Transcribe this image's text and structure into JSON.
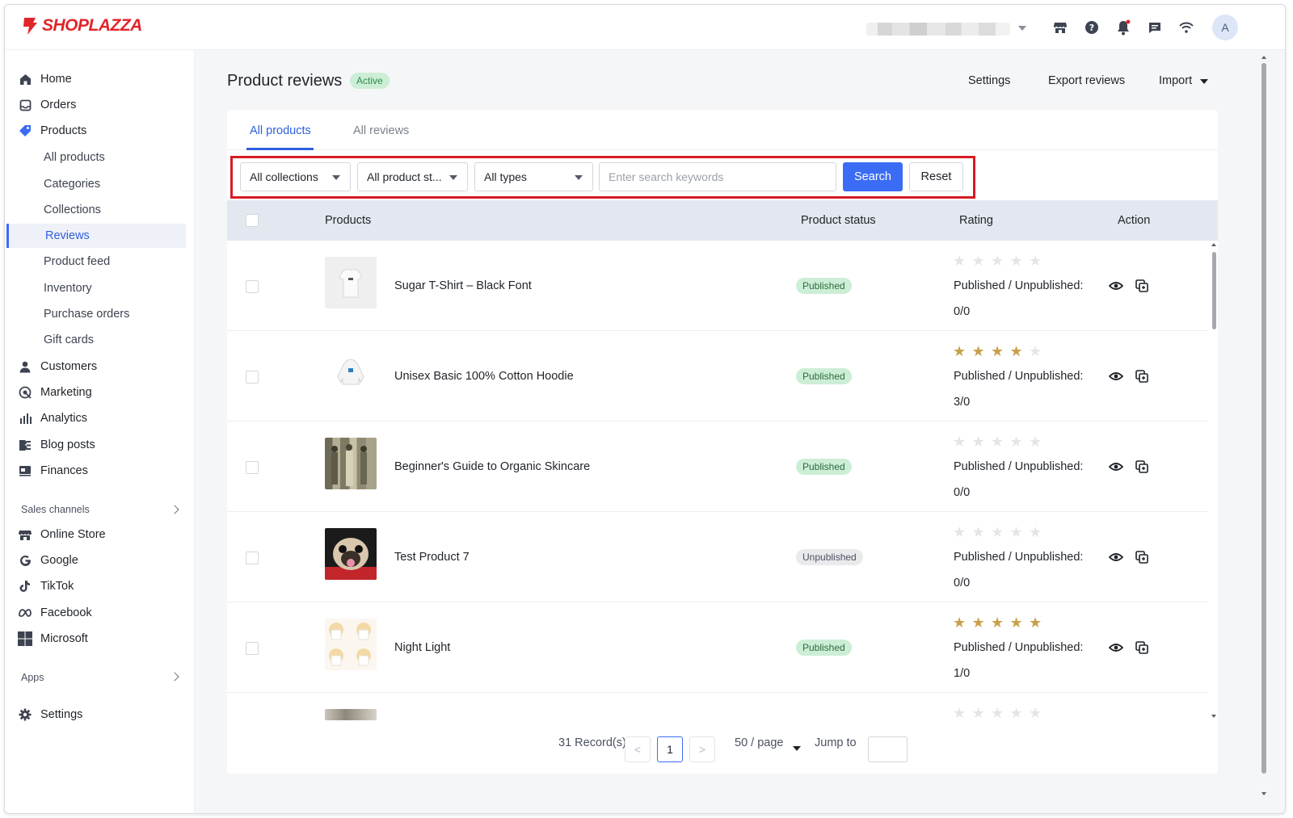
{
  "brand": {
    "name": "SHOPLAZZA",
    "color": "#e0252b"
  },
  "topbar": {
    "icons": [
      "storefront-icon",
      "help-icon",
      "bell-icon",
      "chat-icon",
      "wifi-icon"
    ],
    "avatar_letter": "A"
  },
  "sidebar": {
    "items": [
      {
        "label": "Home",
        "icon": "home-icon"
      },
      {
        "label": "Orders",
        "icon": "orders-icon"
      },
      {
        "label": "Products",
        "icon": "tag-icon"
      },
      {
        "label": "Customers",
        "icon": "person-icon"
      },
      {
        "label": "Marketing",
        "icon": "marketing-icon"
      },
      {
        "label": "Analytics",
        "icon": "analytics-icon"
      },
      {
        "label": "Blog posts",
        "icon": "blog-icon"
      },
      {
        "label": "Finances",
        "icon": "finances-icon"
      }
    ],
    "product_subitems": [
      "All products",
      "Categories",
      "Collections",
      "Reviews",
      "Product feed",
      "Inventory",
      "Purchase orders",
      "Gift cards"
    ],
    "active_subitem": "Reviews",
    "sales_channels_label": "Sales channels",
    "channels": [
      {
        "label": "Online Store",
        "icon": "storefront-icon"
      },
      {
        "label": "Google",
        "icon": "google-icon"
      },
      {
        "label": "TikTok",
        "icon": "tiktok-icon"
      },
      {
        "label": "Facebook",
        "icon": "meta-icon"
      },
      {
        "label": "Microsoft",
        "icon": "microsoft-icon"
      }
    ],
    "apps_label": "Apps",
    "settings_label": "Settings"
  },
  "header": {
    "title": "Product reviews",
    "badge": "Active",
    "settings": "Settings",
    "export": "Export reviews",
    "import": "Import"
  },
  "tabs": [
    {
      "label": "All products",
      "active": true
    },
    {
      "label": "All reviews",
      "active": false
    }
  ],
  "filters": {
    "collections": "All collections",
    "product_status": "All product st...",
    "types": "All types",
    "search_placeholder": "Enter search keywords",
    "search_button": "Search",
    "reset_button": "Reset"
  },
  "table": {
    "columns": [
      "Products",
      "Product status",
      "Rating",
      "Action"
    ],
    "published_label": "Published / Unpublished:",
    "rows": [
      {
        "name": "Sugar T-Shirt – Black Font",
        "status": "Published",
        "rating": 0,
        "counts": "0/0",
        "thumb": "tshirt"
      },
      {
        "name": "Unisex Basic 100% Cotton Hoodie",
        "status": "Published",
        "rating": 4,
        "counts": "3/0",
        "thumb": "hoodie"
      },
      {
        "name": "Beginner's Guide to Organic Skincare",
        "status": "Published",
        "rating": 0,
        "counts": "0/0",
        "thumb": "group"
      },
      {
        "name": "Test Product 7",
        "status": "Unpublished",
        "rating": 0,
        "counts": "0/0",
        "thumb": "pug"
      },
      {
        "name": "Night Light",
        "status": "Published",
        "rating": 5,
        "counts": "1/0",
        "thumb": "lights"
      }
    ]
  },
  "pagination": {
    "records": "31 Record(s)",
    "current_page": "1",
    "prev": "<",
    "next": ">",
    "page_size": "50 / page",
    "jump_to": "Jump to"
  },
  "colors": {
    "accent": "#3b6cf6",
    "highlight": "#d61c25",
    "published_bg": "#cdeed6",
    "star": "#c9a04a"
  }
}
